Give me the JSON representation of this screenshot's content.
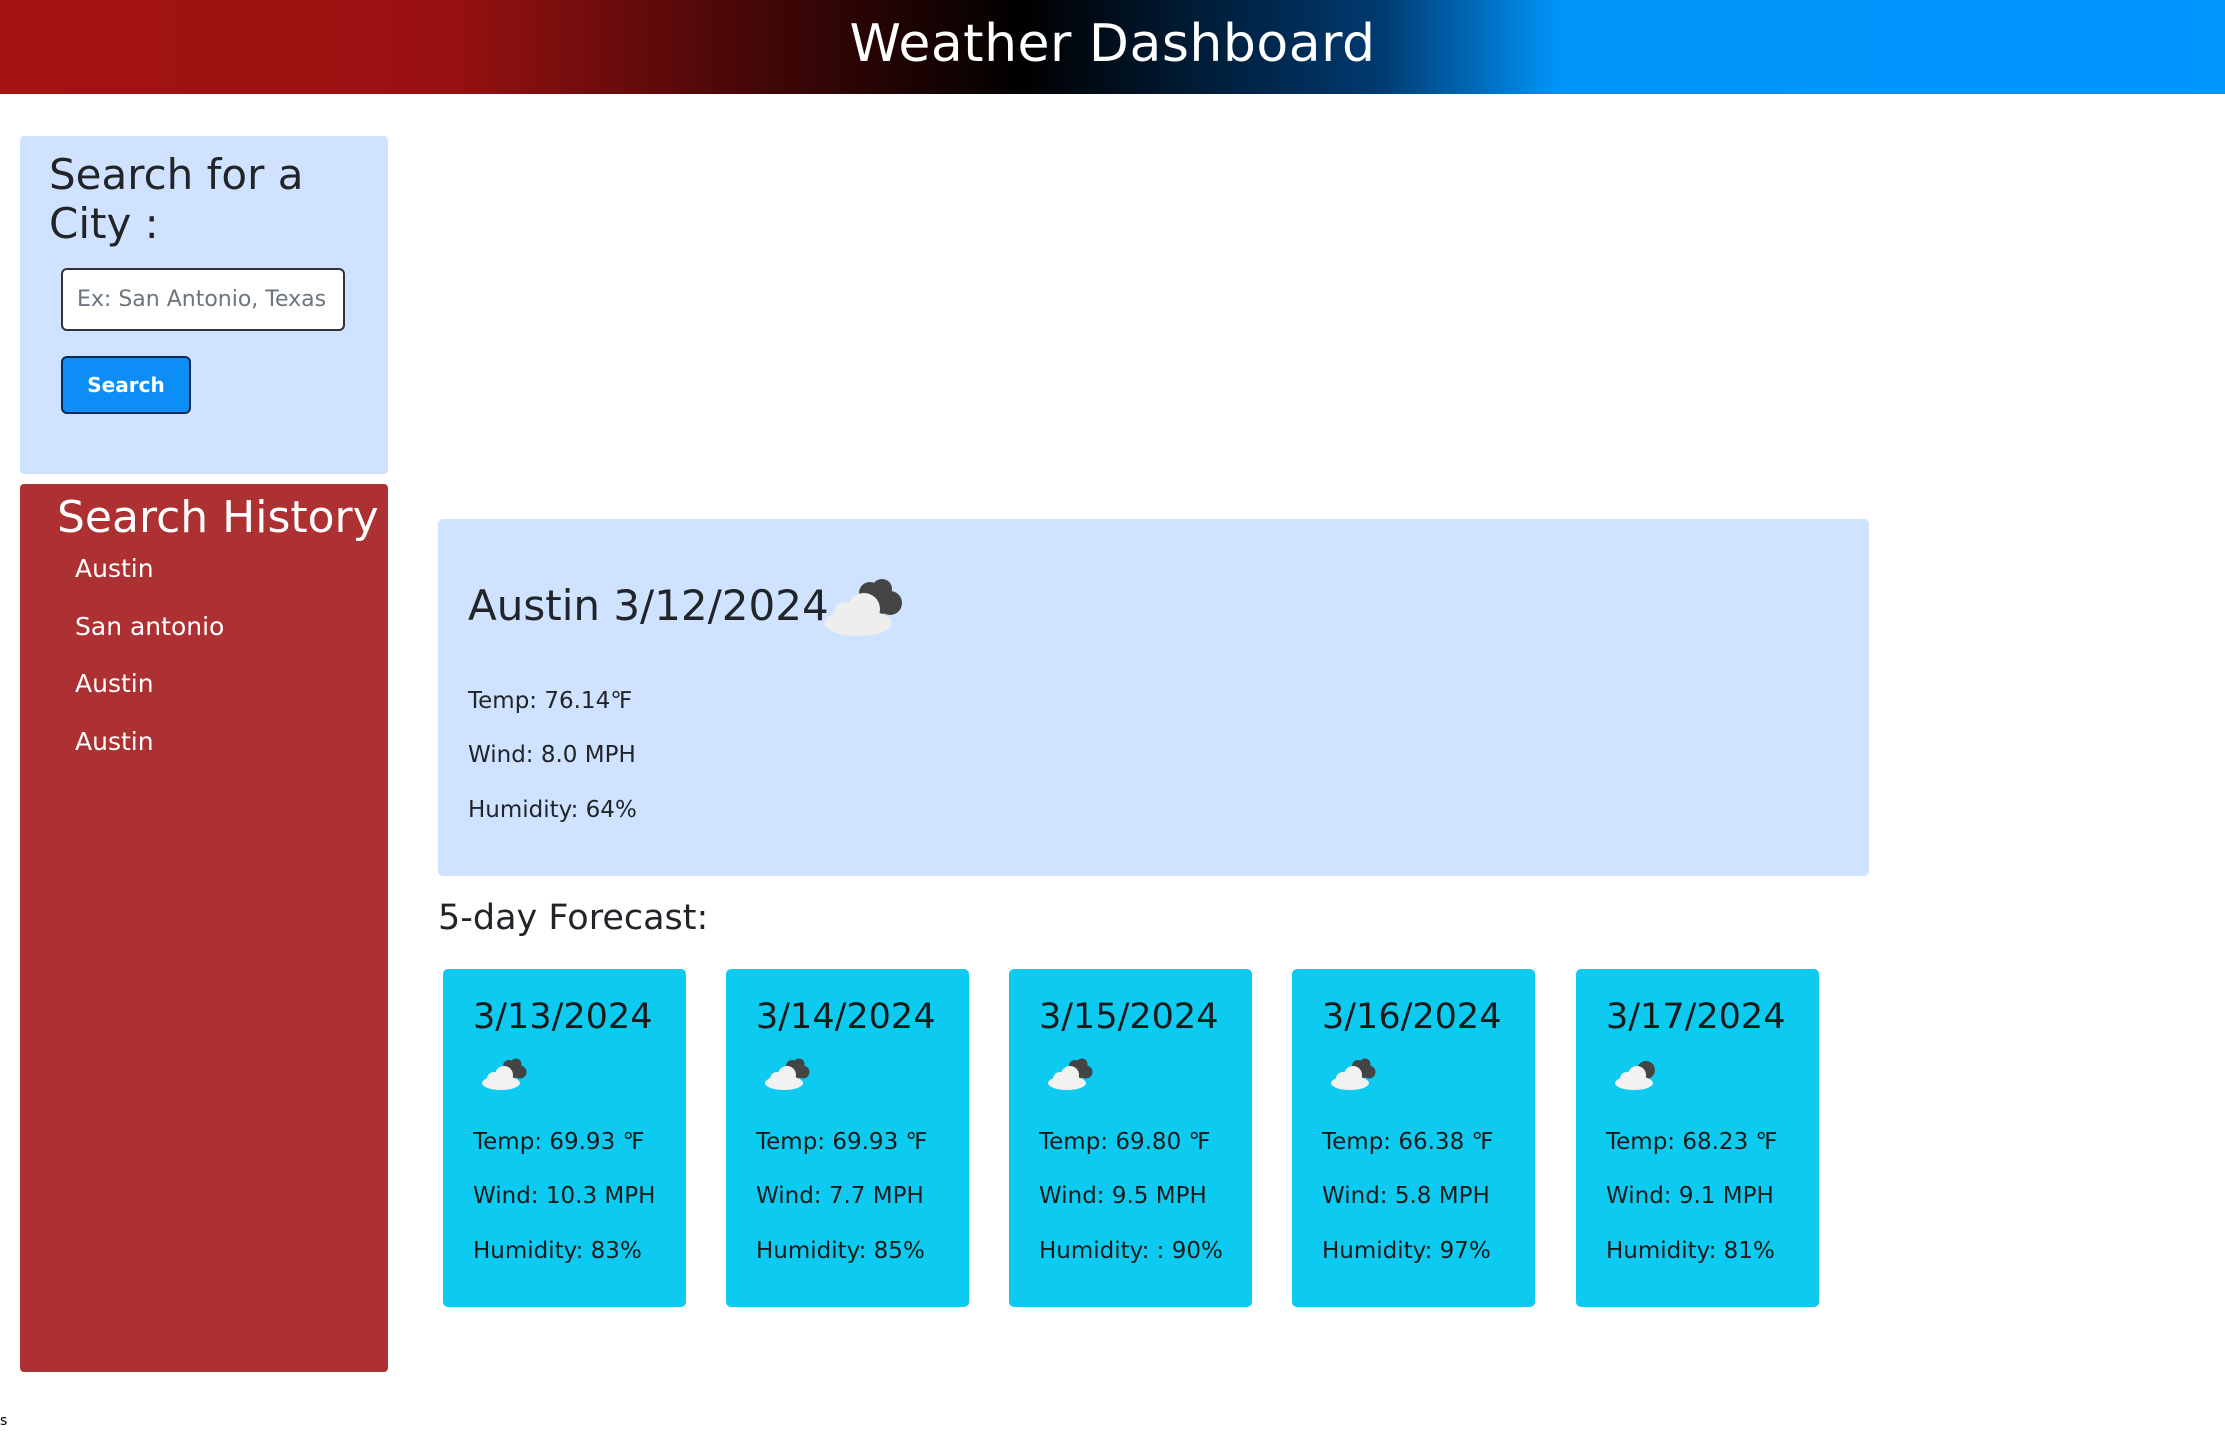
{
  "header": {
    "title": "Weather Dashboard"
  },
  "search": {
    "title": "Search for a City :",
    "placeholder": "Ex: San Antonio, Texas",
    "button_label": "Search"
  },
  "history": {
    "title": "Search History",
    "items": [
      {
        "label": "Austin"
      },
      {
        "label": "San antonio"
      },
      {
        "label": "Austin"
      },
      {
        "label": "Austin"
      }
    ]
  },
  "current": {
    "title": "Austin 3/12/2024",
    "icon": "cloud-icon",
    "temp": "Temp: 76.14℉",
    "wind": "Wind: 8.0 MPH",
    "humidity": "Humidity: 64%"
  },
  "forecast": {
    "heading": "5-day Forecast:",
    "days": [
      {
        "date": "3/13/2024",
        "icon": "cloud-icon",
        "temp": "Temp: 69.93 ℉",
        "wind": "Wind: 10.3 MPH",
        "humidity": "Humidity: 83%"
      },
      {
        "date": "3/14/2024",
        "icon": "cloud-icon",
        "temp": "Temp: 69.93 ℉",
        "wind": "Wind: 7.7 MPH",
        "humidity": "Humidity: 85%"
      },
      {
        "date": "3/15/2024",
        "icon": "cloud-icon",
        "temp": "Temp: 69.80 ℉",
        "wind": "Wind: 9.5 MPH",
        "humidity": "Humidity: : 90%"
      },
      {
        "date": "3/16/2024",
        "icon": "cloud-icon",
        "temp": "Temp: 66.38 ℉",
        "wind": "Wind: 5.8 MPH",
        "humidity": "Humidity: 97%"
      },
      {
        "date": "3/17/2024",
        "icon": "cloud-icon",
        "temp": "Temp: 68.23 ℉",
        "wind": "Wind: 9.1 MPH",
        "humidity": "Humidity: 81%"
      }
    ]
  },
  "footer": {
    "text": "s"
  },
  "colors": {
    "header_red": "#a51212",
    "header_blue": "#0096ff",
    "panel_light_blue": "#cfe2ff",
    "history_red": "#ad3132",
    "forecast_cyan": "#0dcaf0",
    "button_blue": "#0d8ef7"
  }
}
